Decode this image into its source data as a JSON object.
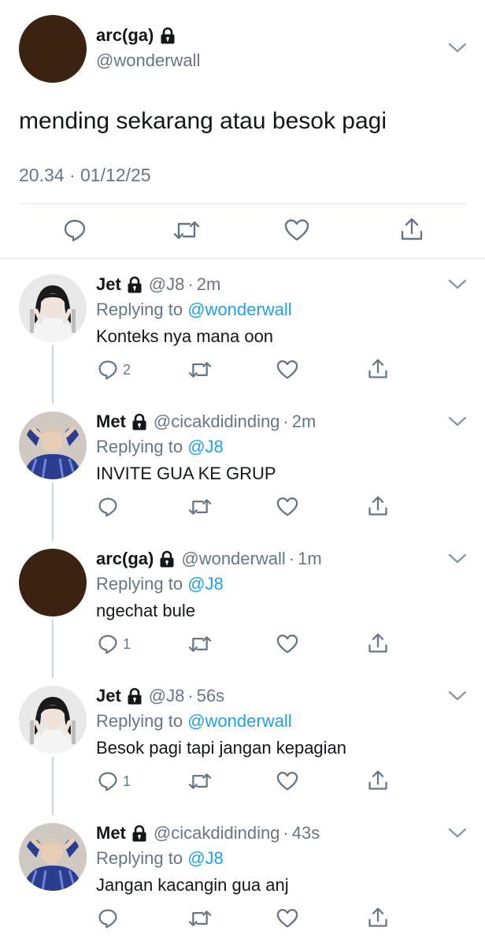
{
  "main_tweet": {
    "name": "arc(ga)",
    "handle": "@wonderwall",
    "text": "mending sekarang atau besok pagi",
    "timestamp": "20.34 · 01/12/25",
    "avatar_color": "#3c2210"
  },
  "colors": {
    "link": "#1da1f2",
    "secondary": "#657786",
    "divider": "#e1e8ed",
    "thread_line": "#ccd6dd"
  },
  "replies": [
    {
      "name": "Jet",
      "handle": "@J8",
      "time": "2m",
      "replying_prefix": "Replying to",
      "replying_to": "@wonderwall",
      "text": "Konteks nya mana oon",
      "reply_count": "2",
      "avatar": "photo-jet"
    },
    {
      "name": "Met",
      "handle": "@cicakdidinding",
      "time": "2m",
      "replying_prefix": "Replying to",
      "replying_to": "@J8",
      "text": "INVITE GUA KE GRUP",
      "reply_count": "",
      "avatar": "photo-met"
    },
    {
      "name": "arc(ga)",
      "handle": "@wonderwall",
      "time": "1m",
      "replying_prefix": "Replying to",
      "replying_to": "@J8",
      "text": "ngechat bule",
      "reply_count": "1",
      "avatar": "solid-brown"
    },
    {
      "name": "Jet",
      "handle": "@J8",
      "time": "56s",
      "replying_prefix": "Replying to",
      "replying_to": "@wonderwall",
      "text": "Besok pagi tapi jangan kepagian",
      "reply_count": "1",
      "avatar": "photo-jet"
    },
    {
      "name": "Met",
      "handle": "@cicakdidinding",
      "time": "43s",
      "replying_prefix": "Replying to",
      "replying_to": "@J8",
      "text": "Jangan kacangin gua anj",
      "reply_count": "",
      "avatar": "photo-met"
    }
  ]
}
